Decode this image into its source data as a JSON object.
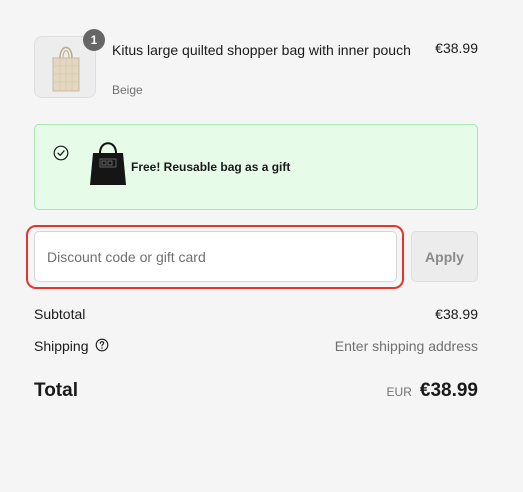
{
  "product": {
    "quantity": "1",
    "title": "Kitus large quilted shopper bag with inner pouch",
    "variant": "Beige",
    "price": "€38.99"
  },
  "gift_banner": {
    "text": "Free! Reusable bag as a gift"
  },
  "discount": {
    "placeholder": "Discount code or gift card",
    "value": "",
    "apply_label": "Apply"
  },
  "summary": {
    "subtotal_label": "Subtotal",
    "subtotal_value": "€38.99",
    "shipping_label": "Shipping",
    "shipping_value": "Enter shipping address",
    "total_label": "Total",
    "currency": "EUR",
    "total_value": "€38.99"
  },
  "icons": {
    "product_image": "tote-bag-image",
    "quantity_badge": "quantity-badge",
    "gift_check": "check-circle-icon",
    "gift_bag": "gift-bag-image",
    "shipping_help": "help-icon"
  },
  "colors": {
    "gift_background": "#e7fbe9",
    "gift_border": "#a9e5b0",
    "focus_outline": "#e5352b"
  }
}
